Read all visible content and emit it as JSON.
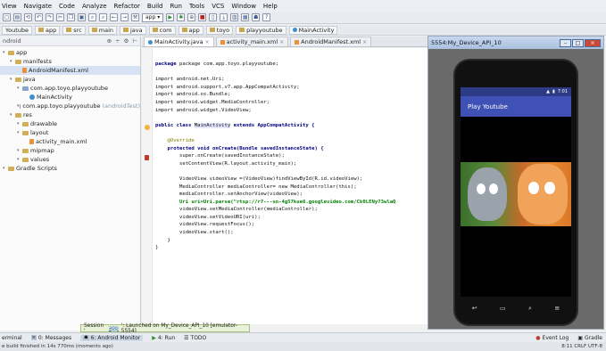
{
  "menubar": [
    "View",
    "Navigate",
    "Code",
    "Analyze",
    "Refactor",
    "Build",
    "Run",
    "Tools",
    "VCS",
    "Window",
    "Help"
  ],
  "toolbar": {
    "app_config": "app"
  },
  "breadcrumbs": [
    "Youtube",
    "app",
    "src",
    "main",
    "java",
    "com",
    "app",
    "toyo",
    "playyoutube",
    "MainActivity"
  ],
  "project": {
    "header_left": "ndroid",
    "tree": [
      {
        "label": "app",
        "indent": 0,
        "icon": "folder"
      },
      {
        "label": "manifests",
        "indent": 1,
        "icon": "folder"
      },
      {
        "label": "AndroidManifest.xml",
        "indent": 2,
        "icon": "file",
        "selected": true
      },
      {
        "label": "java",
        "indent": 1,
        "icon": "folder"
      },
      {
        "label": "com.app.toyo.playyoutube",
        "indent": 2,
        "icon": "folder-blue"
      },
      {
        "label": "MainActivity",
        "indent": 3,
        "icon": "class"
      },
      {
        "label": "com.app.toyo.playyoutube",
        "suffix": "(androidTest)",
        "indent": 2,
        "icon": "folder-blue"
      },
      {
        "label": "res",
        "indent": 1,
        "icon": "folder"
      },
      {
        "label": "drawable",
        "indent": 2,
        "icon": "folder"
      },
      {
        "label": "layout",
        "indent": 2,
        "icon": "folder"
      },
      {
        "label": "activity_main.xml",
        "indent": 3,
        "icon": "file"
      },
      {
        "label": "mipmap",
        "indent": 2,
        "icon": "folder"
      },
      {
        "label": "values",
        "indent": 2,
        "icon": "folder"
      },
      {
        "label": "Gradle Scripts",
        "indent": 0,
        "icon": "folder"
      }
    ]
  },
  "tabs": [
    {
      "label": "MainActivity.java",
      "icon": "class",
      "active": true
    },
    {
      "label": "activity_main.xml",
      "icon": "xml"
    },
    {
      "label": "AndroidManifest.xml",
      "icon": "xml"
    }
  ],
  "code": {
    "l1": "package com.app.toyo.playyoutube;",
    "l3": "import android.net.Uri;",
    "l4": "import android.support.v7.app.AppCompatActivity;",
    "l5": "import android.os.Bundle;",
    "l6": "import android.widget.MediaController;",
    "l7": "import android.widget.VideoView;",
    "l9a": "public class ",
    "l9b": "MainActivity",
    "l9c": " extends AppCompatActivity {",
    "l11": "@Override",
    "l12": "protected void onCreate(Bundle savedInstanceState) {",
    "l13": "super.onCreate(savedInstanceState);",
    "l14": "setContentView(R.layout.activity_main);",
    "l16": "VideoView videoView =(VideoView)findViewById(R.id.videoView);",
    "l17": "MediaController mediaController= new MediaController(this);",
    "l18": "mediaController.setAnchorView(videoView);",
    "l19": "Uri uri=Uri.parse(\"rtsp://r7---sn-4g57kue6.googlevideo.com/Ck0LENy73wlaQ",
    "l20": "videoView.setMediaController(mediaController);",
    "l21": "videoView.setVideoURI(uri);",
    "l22": "videoView.requestFocus();",
    "l23": "videoView.start();",
    "l24": "}",
    "l25": "}"
  },
  "emulator": {
    "title": "5554:My_Device_API_10",
    "status_time": "7:01",
    "app_title": "Play Youtube"
  },
  "toast": {
    "prefix": "Session '",
    "link": "app",
    "suffix": "': Launched on My_Device_API_10 [emulator-5554]"
  },
  "toolwindows": {
    "terminal": "erminal",
    "messages": "0: Messages",
    "monitor": "6: Android Monitor",
    "run": "4: Run",
    "todo": "TODO",
    "eventlog": "Event Log",
    "gradle": "Gradle"
  },
  "statusline": {
    "left": "e build finished in 14s 770ms (moments ago)",
    "right": "8:11  CRLF  UTF-8"
  }
}
